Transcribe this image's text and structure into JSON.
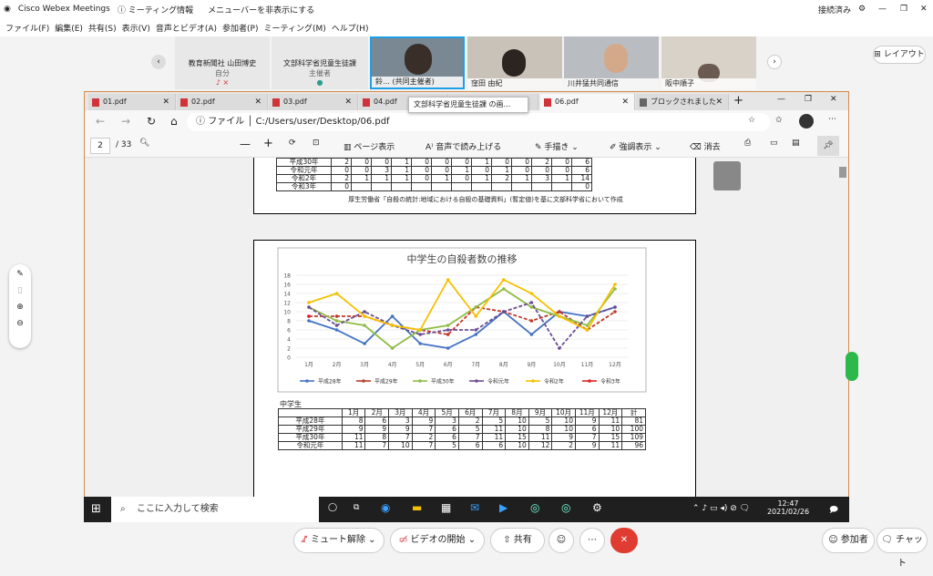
{
  "titlebar": {
    "app": "Cisco Webex Meetings",
    "meeting_info": "ミーティング情報",
    "hide_menu": "メニューバーを非表示にする",
    "status": "接続済み"
  },
  "menu": [
    "ファイル(F)",
    "編集(E)",
    "共有(S)",
    "表示(V)",
    "音声とビデオ(A)",
    "参加者(P)",
    "ミーティング(M)",
    "ヘルプ(H)"
  ],
  "participants": {
    "layout_label": "レイアウト",
    "tiles": [
      {
        "name": "教育新聞社 山田博史",
        "role": "自分"
      },
      {
        "name": "文部科学省児童生徒課",
        "role": "主催者"
      }
    ],
    "videos": [
      {
        "name": "鈴… (共同主催者)"
      },
      {
        "name": "窪田 由紀"
      },
      {
        "name": "川井猛共同通信"
      },
      {
        "name": "阪中順子"
      }
    ]
  },
  "tabs": [
    "01.pdf",
    "02.pdf",
    "03.pdf",
    "04.pdf",
    "06.pdf",
    "ブロックされました"
  ],
  "tooltip": "文部科学省児童生徒課 の画…",
  "address": {
    "prefix": "ファイル",
    "url": "C:/Users/user/Desktop/06.pdf"
  },
  "pdf_toolbar": {
    "page": "2",
    "total": "/ 33",
    "page_view": "ページ表示",
    "read_aloud": "音声で読み上げる",
    "handwrite": "手描き",
    "highlight": "強調表示",
    "erase": "消去"
  },
  "top_table": {
    "rows": [
      {
        "label": "平成30年",
        "values": [
          "2",
          "0",
          "0",
          "1",
          "0",
          "0",
          "0",
          "1",
          "0",
          "0",
          "2",
          "0",
          "6"
        ]
      },
      {
        "label": "令和元年",
        "values": [
          "0",
          "0",
          "3",
          "1",
          "0",
          "0",
          "1",
          "0",
          "1",
          "0",
          "0",
          "0",
          "6"
        ]
      },
      {
        "label": "令和2年",
        "values": [
          "2",
          "1",
          "1",
          "1",
          "0",
          "1",
          "0",
          "1",
          "2",
          "1",
          "3",
          "1",
          "14"
        ]
      },
      {
        "label": "令和3年",
        "values": [
          "0",
          "",
          "",
          "",
          "",
          "",
          "",
          "",
          "",
          "",
          "",
          "",
          "0"
        ]
      }
    ],
    "source": "厚生労働省「自殺の統計:地域における自殺の基礎資料」(暫定値)を基に文部科学省において作成"
  },
  "chart_data": {
    "type": "line",
    "title": "中学生の自殺者数の推移",
    "categories": [
      "1月",
      "2月",
      "3月",
      "4月",
      "5月",
      "6月",
      "7月",
      "8月",
      "9月",
      "10月",
      "11月",
      "12月"
    ],
    "ylim": [
      0,
      18
    ],
    "yticks": [
      0,
      2,
      4,
      6,
      8,
      10,
      12,
      14,
      16,
      18
    ],
    "grid": true,
    "legend": "bottom",
    "series": [
      {
        "name": "平成28年",
        "color": "#4472c4",
        "dash": false,
        "values": [
          8,
          6,
          3,
          9,
          3,
          2,
          5,
          10,
          5,
          10,
          9,
          11
        ]
      },
      {
        "name": "平成29年",
        "color": "#c0392b",
        "dash": true,
        "values": [
          9,
          9,
          9,
          7,
          6,
          5,
          11,
          10,
          8,
          10,
          6,
          10
        ]
      },
      {
        "name": "平成30年",
        "color": "#8fbc45",
        "dash": false,
        "values": [
          11,
          8,
          7,
          2,
          6,
          7,
          11,
          15,
          11,
          9,
          7,
          15
        ]
      },
      {
        "name": "令和元年",
        "color": "#6a4c93",
        "dash": true,
        "values": [
          11,
          7,
          10,
          7,
          5,
          6,
          6,
          10,
          12,
          2,
          9,
          11
        ]
      },
      {
        "name": "令和2年",
        "color": "#f5c000",
        "dash": false,
        "values": [
          12,
          14,
          9,
          7,
          6,
          17,
          9,
          17,
          14,
          9,
          6,
          16
        ]
      },
      {
        "name": "令和3年",
        "color": "#e02020",
        "dash": true,
        "values": [
          9,
          null,
          null,
          null,
          null,
          null,
          null,
          null,
          null,
          null,
          null,
          null
        ]
      }
    ]
  },
  "bottom_table": {
    "caption": "中学生",
    "headers": [
      "1月",
      "2月",
      "3月",
      "4月",
      "5月",
      "6月",
      "7月",
      "8月",
      "9月",
      "10月",
      "11月",
      "12月",
      "計"
    ],
    "rows": [
      {
        "label": "平成28年",
        "values": [
          "8",
          "6",
          "3",
          "9",
          "3",
          "2",
          "5",
          "10",
          "5",
          "10",
          "9",
          "11",
          "81"
        ]
      },
      {
        "label": "平成29年",
        "values": [
          "9",
          "9",
          "9",
          "7",
          "6",
          "5",
          "11",
          "10",
          "8",
          "10",
          "6",
          "10",
          "100"
        ]
      },
      {
        "label": "平成30年",
        "values": [
          "11",
          "8",
          "7",
          "2",
          "6",
          "7",
          "11",
          "15",
          "11",
          "9",
          "7",
          "15",
          "109"
        ]
      },
      {
        "label": "令和元年",
        "values": [
          "11",
          "7",
          "10",
          "7",
          "5",
          "6",
          "6",
          "10",
          "12",
          "2",
          "9",
          "11",
          "96"
        ]
      }
    ]
  },
  "taskbar": {
    "search": "ここに入力して検索",
    "time": "12:47",
    "date": "2021/02/26"
  },
  "bottombar": {
    "mute": "ミュート解除",
    "video": "ビデオの開始",
    "share": "共有",
    "participants": "参加者",
    "chat": "チャット"
  }
}
